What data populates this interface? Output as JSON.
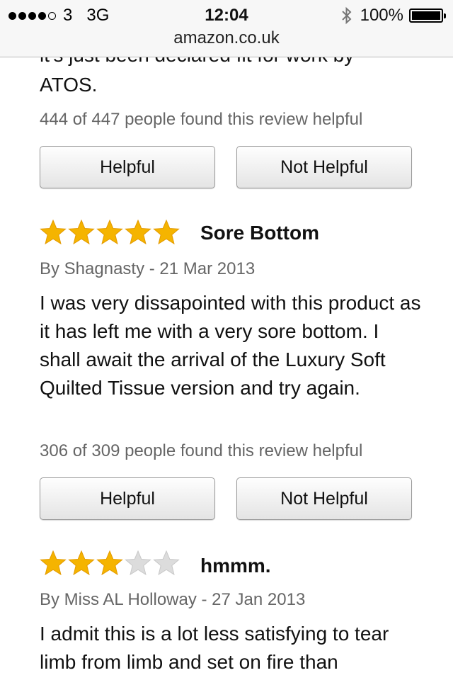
{
  "status": {
    "carrier": "3",
    "network": "3G",
    "time": "12:04",
    "battery": "100%",
    "url": "amazon.co.uk"
  },
  "previous_review": {
    "cut_text": "it's just been declared fit for work by",
    "last_line": "ATOS.",
    "helpful_text": "444 of 447 people found this review helpful",
    "helpful_label": "Helpful",
    "not_helpful_label": "Not Helpful"
  },
  "reviews": [
    {
      "rating": 5,
      "title": "Sore Bottom",
      "byline": "By Shagnasty - 21 Mar 2013",
      "body": "I was very dissapointed with this product as it has left me with a very sore bottom. I shall await the arrival of the Luxury Soft Quilted Tissue version and try again.",
      "helpful_text": "306 of 309 people found this review helpful",
      "helpful_label": "Helpful",
      "not_helpful_label": "Not Helpful"
    },
    {
      "rating": 3,
      "title": "hmmm.",
      "byline": "By Miss AL Holloway - 27 Jan 2013",
      "body": "I admit this is a lot less satisfying to tear limb from limb and set on fire than"
    }
  ],
  "colors": {
    "star_filled": "#f5b400",
    "star_empty": "#dcdcdc"
  }
}
